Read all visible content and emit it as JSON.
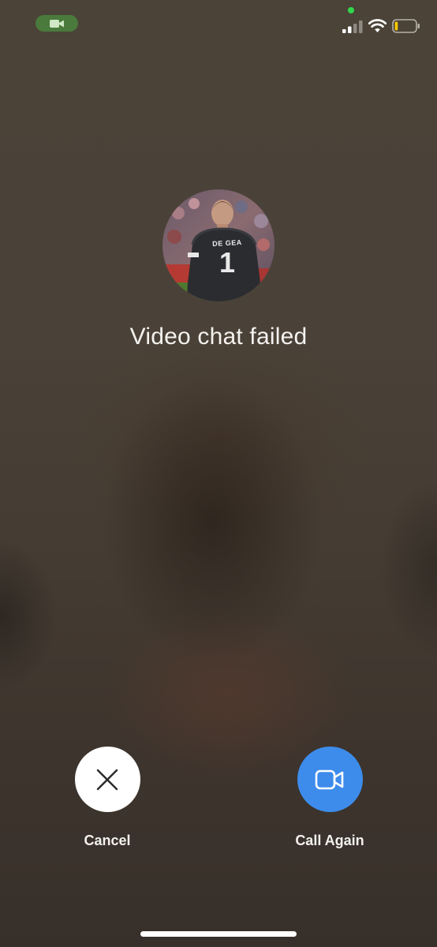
{
  "status_bar": {
    "camera_indicator_icon": "video-camera-icon",
    "camera_indicator_color": "#4a7a3c",
    "privacy_dot_color": "#2fd84a",
    "signal_icon": "cellular-signal-icon",
    "wifi_icon": "wifi-icon",
    "battery_icon": "battery-low-icon",
    "battery_level": 0.15,
    "battery_fill_color": "#f6c700"
  },
  "contact": {
    "avatar_icon": "contact-photo",
    "jersey_text": "DE GEA",
    "jersey_number": "1"
  },
  "call": {
    "status_text": "Video chat failed"
  },
  "actions": {
    "cancel": {
      "label": "Cancel",
      "icon": "close-icon",
      "color": "#ffffff"
    },
    "call_again": {
      "label": "Call Again",
      "icon": "video-camera-icon",
      "color": "#3d8cec"
    }
  }
}
